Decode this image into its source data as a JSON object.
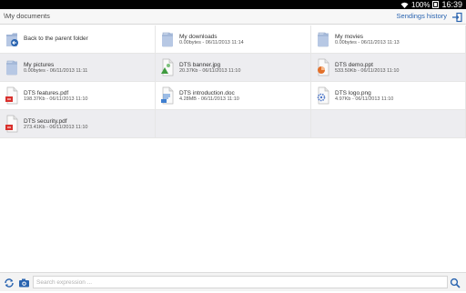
{
  "status": {
    "battery": "100%",
    "time": "16:39"
  },
  "header": {
    "path": "\\My documents",
    "history_label": "Sendings history"
  },
  "files": [
    {
      "name": "Back to the parent folder",
      "meta": "",
      "icon": "parent-folder-icon",
      "type": "parent"
    },
    {
      "name": "My downloads",
      "meta": "0.00bytes - 06/11/2013 11:14",
      "icon": "folder-icon",
      "type": "folder"
    },
    {
      "name": "My movies",
      "meta": "0.00bytes - 06/11/2013 11:13",
      "icon": "folder-icon",
      "type": "folder"
    },
    {
      "name": "My pictures",
      "meta": "0.00bytes - 06/11/2013 11:11",
      "icon": "folder-icon",
      "type": "folder"
    },
    {
      "name": "DTS banner.jpg",
      "meta": "20.37Kb - 06/11/2013 11:10",
      "icon": "jpg-file-icon",
      "type": "jpg"
    },
    {
      "name": "DTS demo.ppt",
      "meta": "533.50Kb - 06/11/2013 11:10",
      "icon": "ppt-file-icon",
      "type": "ppt"
    },
    {
      "name": "DTS features.pdf",
      "meta": "198.37Kb - 06/11/2013 11:10",
      "icon": "pdf-file-icon",
      "type": "pdf"
    },
    {
      "name": "DTS introduction.doc",
      "meta": "4.28MB - 06/11/2013 11:10",
      "icon": "doc-file-icon",
      "type": "doc"
    },
    {
      "name": "DTS logo.png",
      "meta": "4.97Kb - 06/11/2013 11:10",
      "icon": "png-file-icon",
      "type": "png"
    },
    {
      "name": "DTS security.pdf",
      "meta": "273.41Kb - 06/11/2013 11:10",
      "icon": "pdf-file-icon",
      "type": "pdf"
    }
  ],
  "search": {
    "placeholder": "Search expression ...",
    "value": ""
  },
  "colors": {
    "accent": "#2a64b0",
    "folder": "#9fb4d6",
    "pdf": "#d9302c",
    "jpg": "#3e9a3e",
    "ppt": "#e2702a",
    "doc": "#3f7fd0",
    "png": "#4a74c8",
    "shaded_row": "#ededf0"
  }
}
